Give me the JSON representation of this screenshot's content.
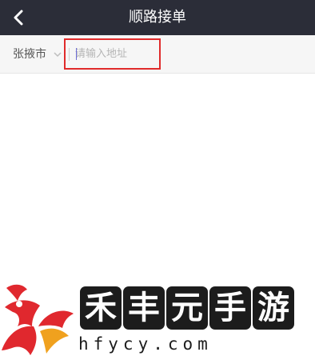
{
  "header": {
    "title": "顺路接单",
    "back_icon": "chevron-left-icon"
  },
  "search": {
    "city": "张掖市",
    "city_caret_icon": "chevron-down-icon",
    "address_placeholder": "请输入地址",
    "address_value": ""
  },
  "watermark": {
    "brand": "禾丰元手游",
    "url": "hfycy.com"
  },
  "colors": {
    "header_bg": "#2b2d38",
    "highlight_border": "#e02b2b",
    "logo_red": "#e0282e",
    "logo_orange": "#f0a11e"
  }
}
